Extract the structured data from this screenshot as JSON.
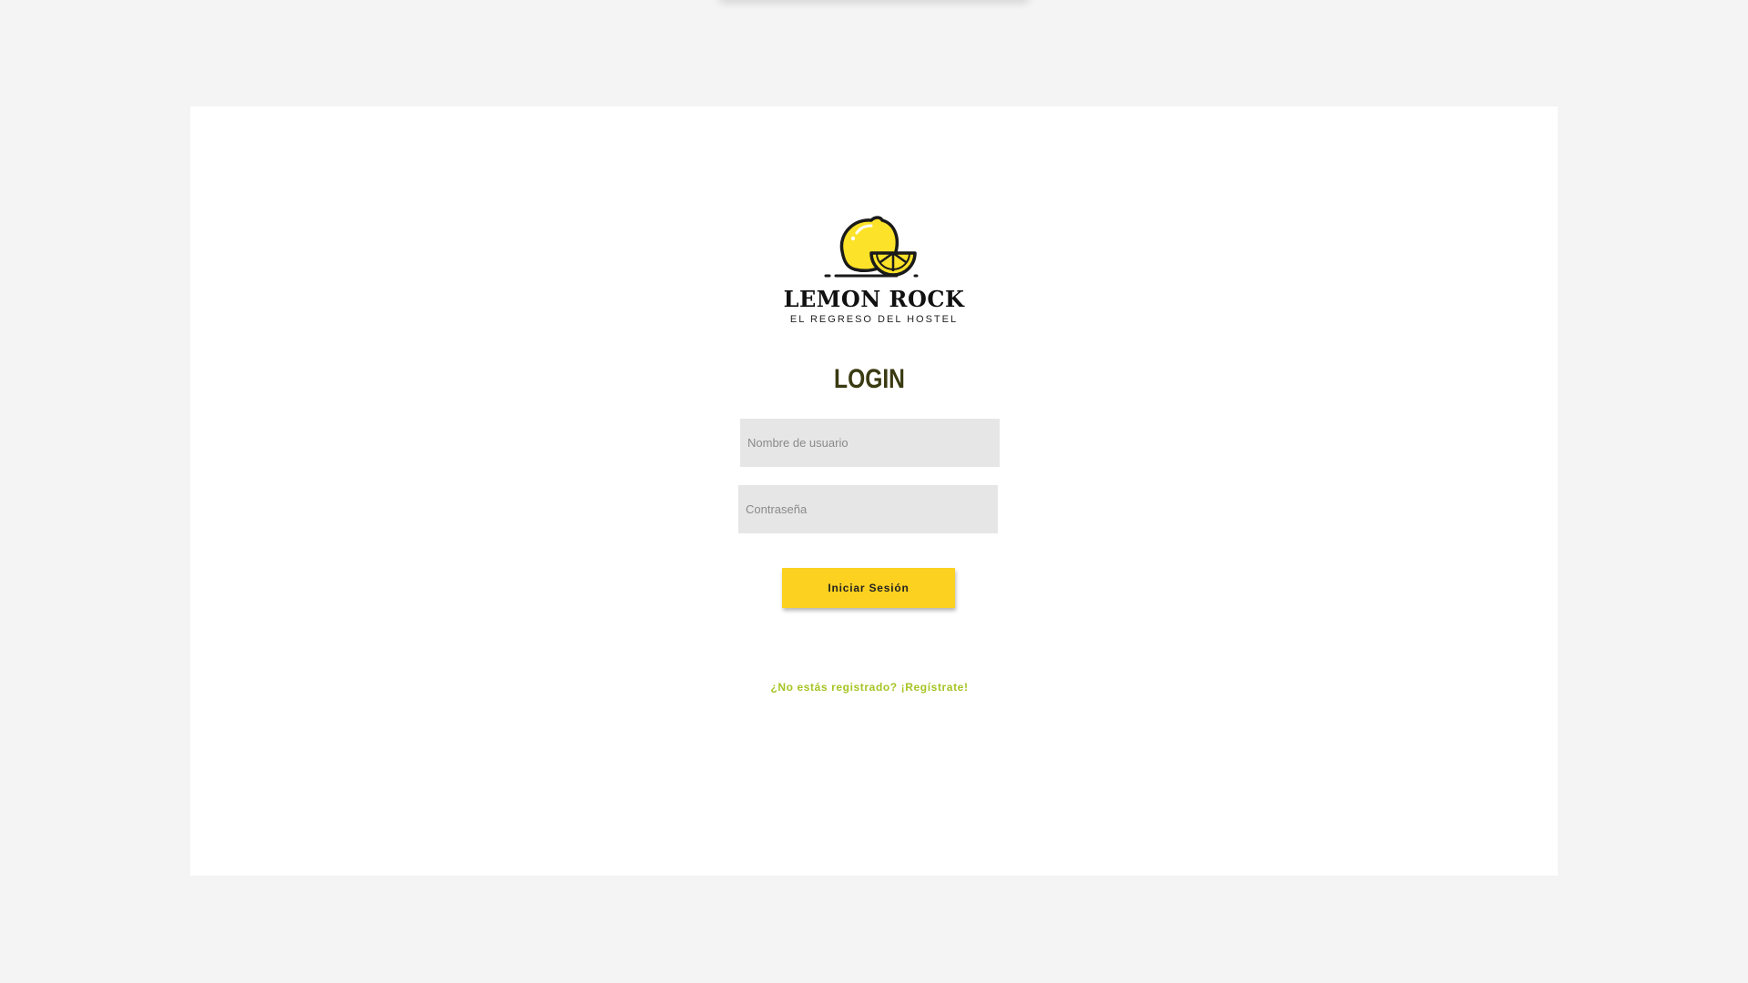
{
  "brand": {
    "name": "LEMON ROCK",
    "tagline": "EL REGRESO DEL HOSTEL",
    "logo_icon": "lemon-icon",
    "lemon_color": "#fce228",
    "outline_color": "#1a1a1a"
  },
  "login": {
    "title": "LOGIN",
    "username_placeholder": "Nombre de usuario",
    "username_value": "",
    "password_placeholder": "Contraseña",
    "password_value": "",
    "submit_label": "Iniciar Sesión",
    "register_link": "¿No estás registrado? ¡Regístrate!"
  },
  "colors": {
    "background": "#f4f4f4",
    "card": "#ffffff",
    "button": "#fcd11f",
    "link": "#a6c424",
    "field": "#e6e6e6"
  }
}
